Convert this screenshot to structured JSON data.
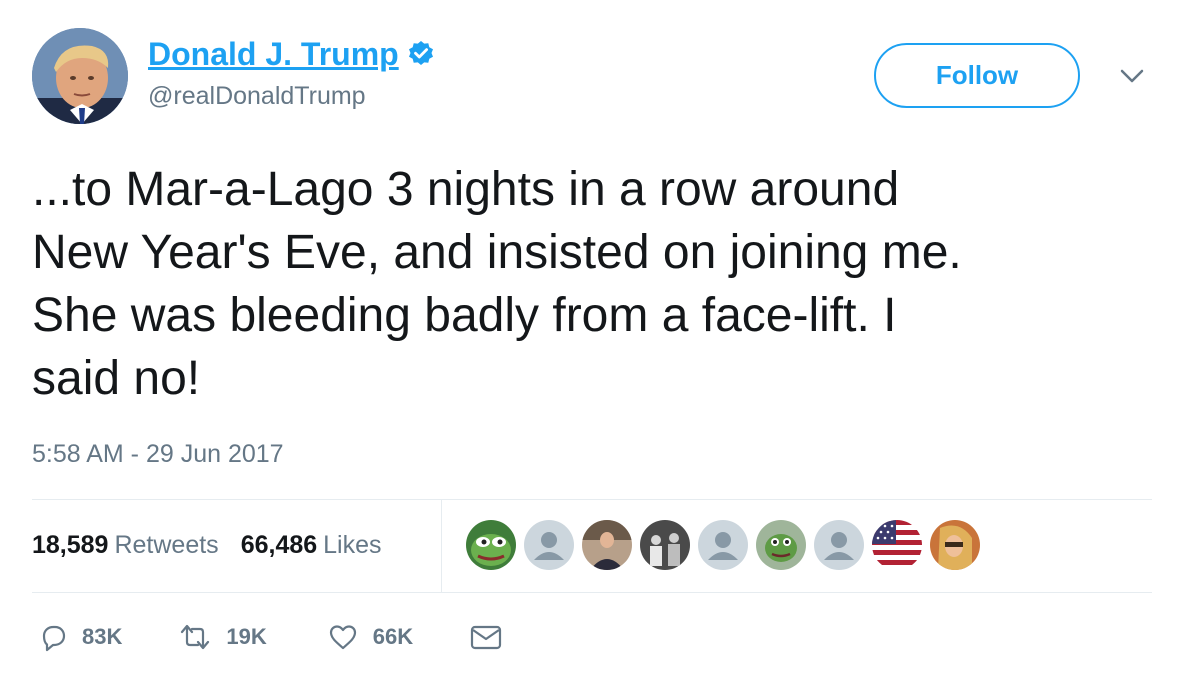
{
  "user": {
    "name": "Donald J. Trump",
    "handle": "@realDonaldTrump",
    "verified": true
  },
  "follow_button": {
    "label": "Follow"
  },
  "tweet": {
    "text": "...to Mar-a-Lago 3 nights in a row around\nNew Year's Eve, and insisted on joining me.\nShe was bleeding badly from a face-lift. I\nsaid no!",
    "timestamp": "5:58 AM - 29 Jun 2017"
  },
  "stats": {
    "retweets_count": "18,589",
    "retweets_label": "Retweets",
    "likes_count": "66,486",
    "likes_label": "Likes"
  },
  "likers": [
    "pepe-frog-avatar",
    "default-avatar",
    "person-photo-avatar",
    "group-photo-avatar",
    "default-avatar",
    "pepe-frog-avatar",
    "default-avatar",
    "american-flag-avatar",
    "person-photo-avatar"
  ],
  "actions": {
    "replies": "83K",
    "retweets": "19K",
    "likes": "66K"
  },
  "colors": {
    "accent": "#1da1f2",
    "text": "#14171a",
    "secondary": "#657786",
    "divider": "#e6ecf0"
  }
}
